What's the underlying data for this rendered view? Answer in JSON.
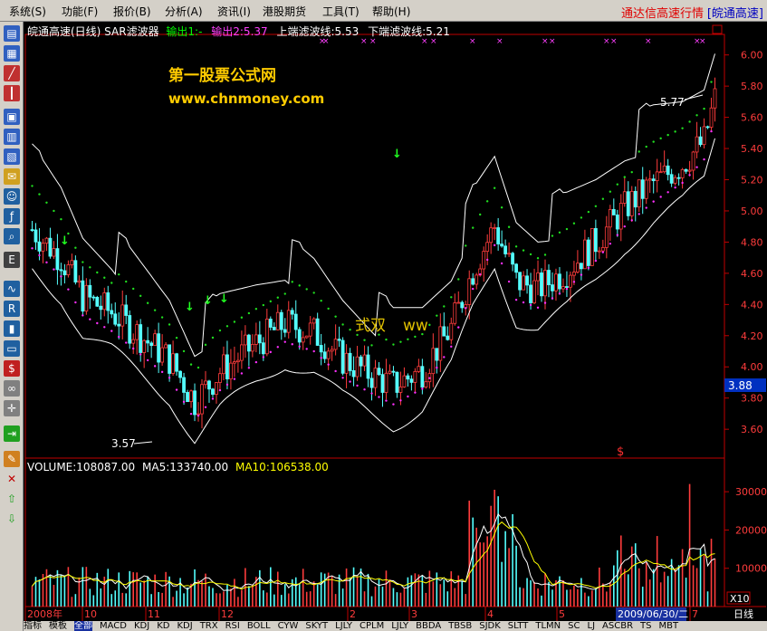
{
  "menu": {
    "items": [
      "系统(S)",
      "功能(F)",
      "报价(B)",
      "分析(A)",
      "资讯(I)",
      "港股期货",
      "工具(T)",
      "帮助(H)"
    ],
    "app_title": "通达信高速行情",
    "stock_label": "[皖通高速]"
  },
  "indicator_header": {
    "title": "皖通高速(日线) SAR滤波器",
    "out1": "输出1:-",
    "out2": "输出2:5.37",
    "upper": "上端滤波线:5.53",
    "lower": "下端滤波线:5.21"
  },
  "volume_header": {
    "volume": "VOLUME:108087.00",
    "ma5": "MA5:133740.00",
    "ma10": "MA10:106538.00"
  },
  "watermark": {
    "title": "第一股票公式网",
    "url": "www.chnmoney.com"
  },
  "annotations": {
    "high_label": "5.77",
    "low_label": "3.57",
    "price_marker": "3.88",
    "mid_text_1": "式双",
    "mid_text_2": "ww",
    "dollar": "$"
  },
  "bottom": {
    "period": "日线",
    "date_badge": "2009/06/30/二",
    "vol_scale": "X10",
    "tabs": [
      "指标",
      "模板",
      "全部",
      "MACD",
      "KDJ",
      "KD",
      "KDJ",
      "TRX",
      "RSI",
      "BOLL",
      "CYW",
      "SKYT",
      "LJLY",
      "CPLM",
      "LJLY",
      "BBDA",
      "TBSB",
      "SJDK",
      "SLTT",
      "TLMN",
      "SC",
      "LJ",
      "ASCBR",
      "TS",
      "MBT"
    ]
  },
  "colors": {
    "up": "#ff3c3c",
    "down": "#54ffff",
    "bg": "#000000",
    "axis": "#c00000",
    "yellow": "#ffcc00"
  },
  "chart_data": [
    {
      "type": "candlestick",
      "ylim": [
        3.45,
        6.12
      ],
      "y_ticks": [
        3.6,
        3.8,
        4.0,
        4.2,
        4.4,
        4.6,
        4.8,
        5.0,
        5.2,
        5.4,
        5.6,
        5.8,
        6.0
      ],
      "x_tick_labels": [
        "2008年",
        "10",
        "11",
        "12",
        "2",
        "3",
        "4",
        "5",
        "6",
        "7"
      ],
      "series": [
        {
          "name": "输出1",
          "values": []
        },
        {
          "name": "输出2",
          "values": []
        },
        {
          "name": "上端滤波线",
          "values": []
        },
        {
          "name": "下端滤波线",
          "values": []
        }
      ],
      "annotations": [
        {
          "label": "5.77",
          "value": 5.77
        },
        {
          "label": "3.57",
          "value": 3.57
        }
      ]
    },
    {
      "type": "bar",
      "ylim": [
        0,
        35000
      ],
      "y_ticks": [
        10000,
        20000,
        30000
      ],
      "series": [
        {
          "name": "VOLUME",
          "values": []
        },
        {
          "name": "MA5",
          "values": []
        },
        {
          "name": "MA10",
          "values": []
        }
      ]
    }
  ]
}
